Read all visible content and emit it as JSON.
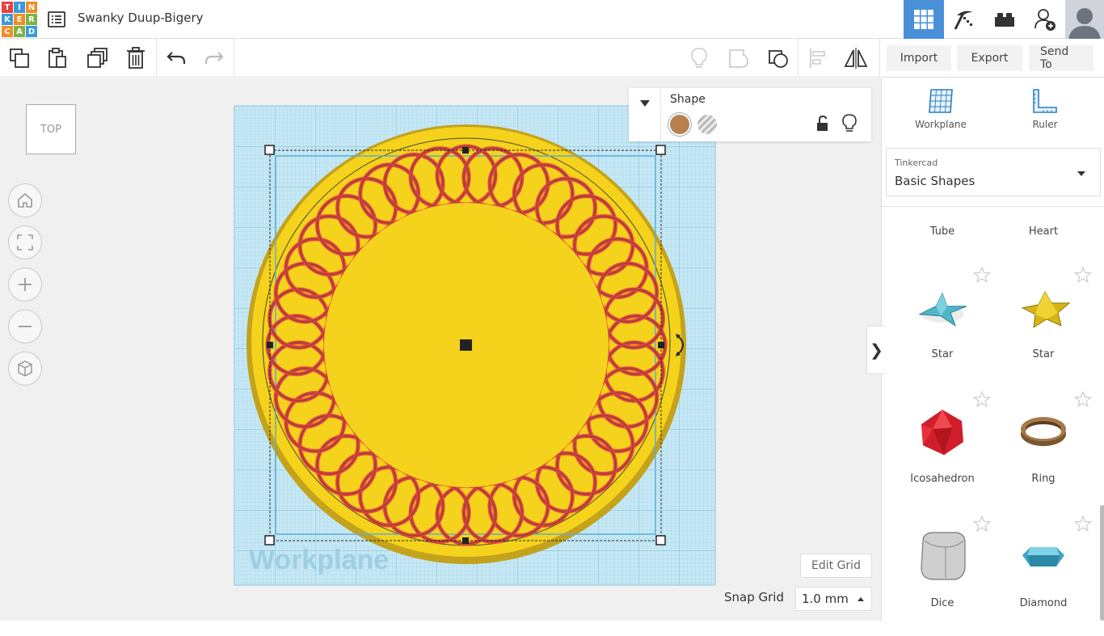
{
  "app": {
    "logo_letters": [
      "T",
      "I",
      "N",
      "K",
      "E",
      "R",
      "C",
      "A",
      "D"
    ],
    "doc_title": "Swanky Duup-Bigery"
  },
  "toolbar": {
    "import_label": "Import",
    "export_label": "Export",
    "send_to_label": "Send To"
  },
  "view": {
    "cube_label": "TOP",
    "workplane_label": "Workplane"
  },
  "shape_panel": {
    "title": "Shape",
    "solid_color": "#b8804f"
  },
  "grid": {
    "edit_label": "Edit Grid",
    "snap_label": "Snap Grid",
    "snap_value": "1.0 mm"
  },
  "sidebar": {
    "workplane_label": "Workplane",
    "ruler_label": "Ruler",
    "library_source": "Tinkercad",
    "library_name": "Basic Shapes",
    "partial_row": [
      "Tube",
      "Heart"
    ],
    "shapes": [
      {
        "name": "Star",
        "icon": "star-blue-icon"
      },
      {
        "name": "Star",
        "icon": "star-yellow-icon"
      },
      {
        "name": "Icosahedron",
        "icon": "icosahedron-icon"
      },
      {
        "name": "Ring",
        "icon": "ring-icon"
      },
      {
        "name": "Dice",
        "icon": "dice-icon"
      },
      {
        "name": "Diamond",
        "icon": "diamond-icon"
      }
    ]
  },
  "colors": {
    "accent": "#4a90d9",
    "workplane": "#bfe3f2",
    "disc": "#f5d21c",
    "rings": "#e8413c"
  }
}
